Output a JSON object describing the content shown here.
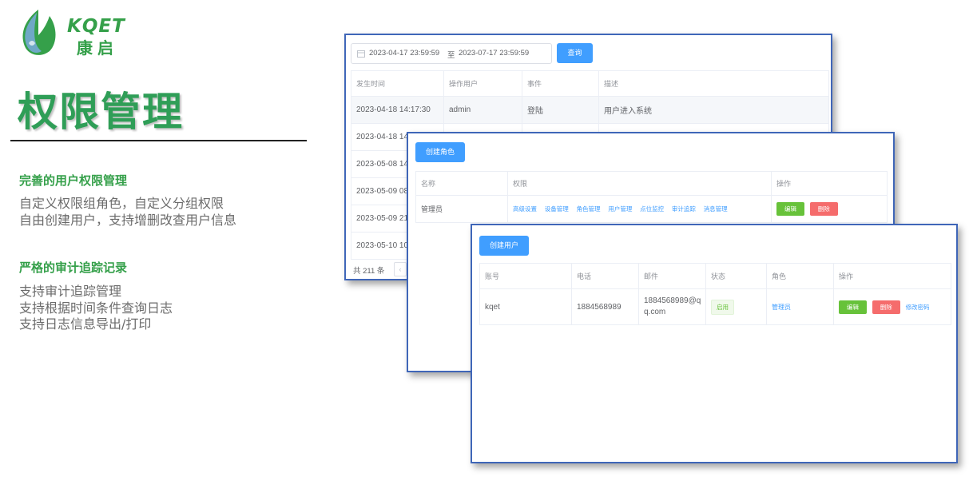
{
  "brand": {
    "logo_en": "KQET",
    "logo_cn": "康启",
    "title": "权限管理"
  },
  "features": [
    {
      "heading": "完善的用户权限管理",
      "lines": [
        "自定义权限组角色，自定义分组权限",
        "自由创建用户，支持增删改查用户信息"
      ]
    },
    {
      "heading": "严格的审计追踪记录",
      "lines": [
        "支持审计追踪管理",
        "支持根据时间条件查询日志",
        "支持日志信息导出/打印"
      ]
    }
  ],
  "audit": {
    "date_start": "2023-04-17 23:59:59",
    "date_sep": "至",
    "date_end": "2023-07-17 23:59:59",
    "query_button": "查询",
    "columns": [
      "发生时间",
      "操作用户",
      "事件",
      "描述"
    ],
    "rows": [
      [
        "2023-04-18 14:17:30",
        "admin",
        "登陆",
        "用户进入系统"
      ],
      [
        "2023-04-18 14",
        "",
        "",
        ""
      ],
      [
        "2023-05-08 14",
        "",
        "",
        ""
      ],
      [
        "2023-05-09 08",
        "",
        "",
        ""
      ],
      [
        "2023-05-09 21",
        "",
        "",
        ""
      ],
      [
        "2023-05-10 10",
        "",
        "",
        ""
      ]
    ],
    "total": "共 211 条"
  },
  "roles": {
    "create_button": "创建角色",
    "columns": [
      "名称",
      "权限",
      "操作"
    ],
    "rows": [
      {
        "name": "管理员",
        "permissions": [
          "高级设置",
          "设备管理",
          "角色管理",
          "用户管理",
          "点位监控",
          "审计追踪",
          "消息管理"
        ],
        "edit": "编辑",
        "delete": "删除"
      }
    ]
  },
  "users": {
    "create_button": "创建用户",
    "columns": [
      "账号",
      "电话",
      "邮件",
      "状态",
      "角色",
      "操作"
    ],
    "rows": [
      {
        "account": "kqet",
        "phone": "1884568989",
        "email_line1": "1884568989@q",
        "email_line2": "q.com",
        "status": "启用",
        "role": "管理员",
        "edit": "编辑",
        "delete": "删除",
        "change_password": "修改密码"
      }
    ]
  },
  "colors": {
    "brand_green": "#35a04a",
    "primary_blue": "#409eff",
    "success_green": "#67c23a",
    "danger_red": "#f56c6c",
    "window_border": "#3f66b8"
  }
}
